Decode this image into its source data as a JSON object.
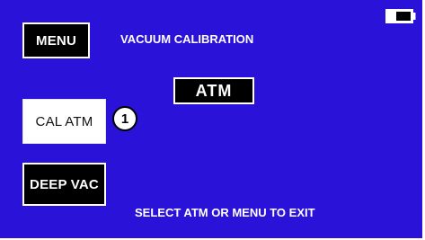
{
  "screen": {
    "background_color": "#2a12d8",
    "title": "VACUUM CALIBRATION",
    "instruction": "SELECT ATM OR MENU TO EXIT"
  },
  "buttons": {
    "menu": "MENU",
    "cal_atm": "CAL ATM",
    "deep_vac": "DEEP VAC"
  },
  "display": {
    "mode": "ATM"
  },
  "callout": {
    "number": "1"
  },
  "status": {
    "battery_icon": "battery-icon"
  }
}
